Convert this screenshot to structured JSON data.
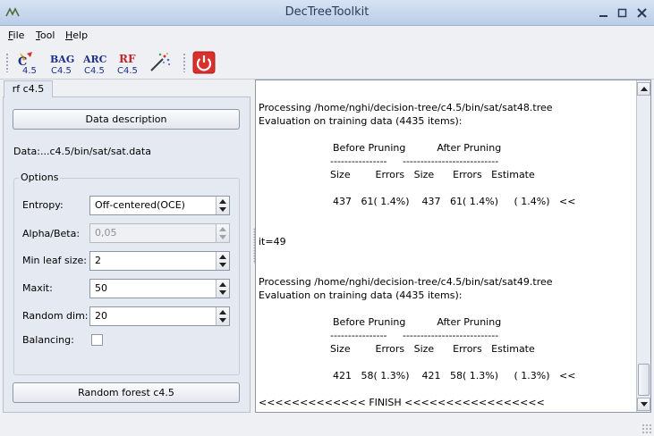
{
  "window": {
    "title": "DecTreeToolkit"
  },
  "menu": {
    "file": "ile",
    "file_mn": "F",
    "tool": "ool",
    "tool_mn": "T",
    "help": "elp",
    "help_mn": "H"
  },
  "toolbar": {
    "buttons": [
      {
        "icon": "c45-icon",
        "text_top": "C",
        "text_bottom": "4.5"
      },
      {
        "icon": "bag-c45-icon",
        "text_top": "BAG",
        "text_bottom": "C4.5"
      },
      {
        "icon": "arc-c45-icon",
        "text_top": "ARC",
        "text_bottom": "C4.5"
      },
      {
        "icon": "rf-c45-icon",
        "text_top": "RF",
        "text_bottom": "C4.5"
      },
      {
        "icon": "magic-wand-icon"
      },
      {
        "icon": "power-icon"
      }
    ]
  },
  "tab": {
    "label": "rf c4.5"
  },
  "left": {
    "data_description_button": "Data description",
    "data_label": "Data:...c4.5/bin/sat/sat.data",
    "options_title": "Options",
    "fields": {
      "entropy_label": "Entropy:",
      "entropy_value": "Off-centered(OCE)",
      "alpha_label": "Alpha/Beta:",
      "alpha_value": "0,05",
      "minleaf_label": "Min leaf size:",
      "minleaf_value": "2",
      "maxit_label": "Maxit:",
      "maxit_value": "50",
      "randomdim_label": "Random dim:",
      "randomdim_value": "20",
      "balancing_label": "Balancing:"
    },
    "run_button": "Random forest c4.5"
  },
  "output": {
    "lines": [
      "Processing /home/nghi/decision-tree/c4.5/bin/sat/sat48.tree",
      "Evaluation on training data (4435 items):",
      "Before Pruning          After Pruning",
      "----------------     ---------------------------",
      "Size        Errors   Size      Errors   Estimate",
      "437   61( 1.4%)    437   61( 1.4%)     ( 1.4%)   <<",
      "it=49",
      "Processing /home/nghi/decision-tree/c4.5/bin/sat/sat49.tree",
      "Evaluation on training data (4435 items):",
      "Before Pruning          After Pruning",
      "----------------     ---------------------------",
      "Size        Errors   Size      Errors   Estimate",
      "421   58( 1.3%)    421   58( 1.3%)     ( 1.3%)   <<",
      "<<<<<<<<<<<<< FINISH <<<<<<<<<<<<<<<<<"
    ]
  },
  "colors": {
    "power_red": "#d9302b",
    "accent_blue": "#1b2f8a",
    "rf_red": "#c0272d"
  }
}
